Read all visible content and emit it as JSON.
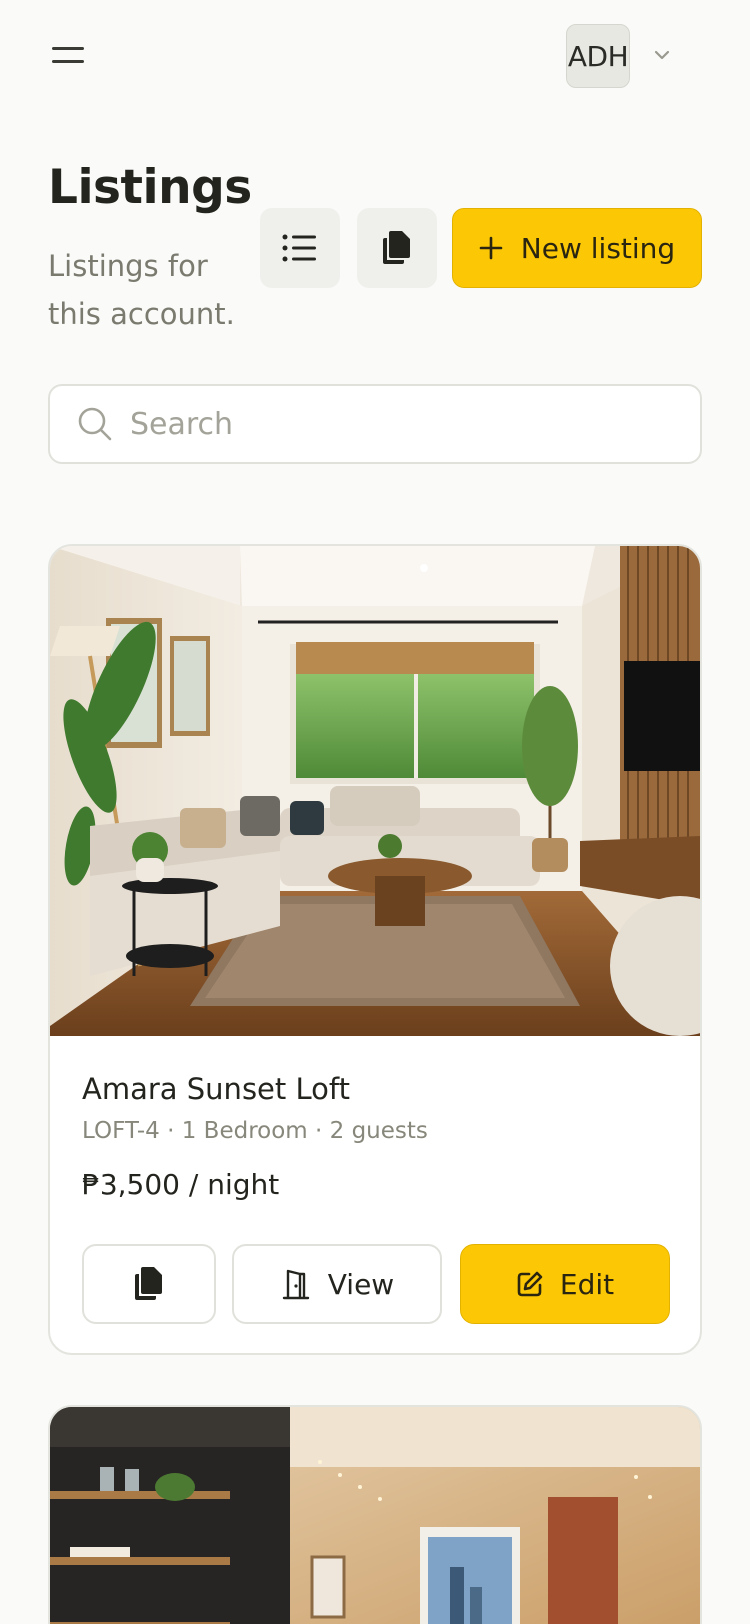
{
  "header": {
    "avatar_initials": "ADH"
  },
  "page": {
    "title": "Listings",
    "subtitle": "Listings for this account.",
    "new_listing_label": "New listing"
  },
  "search": {
    "placeholder": "Search"
  },
  "listings": [
    {
      "name": "Amara Sunset Loft",
      "meta": "LOFT-4 · 1 Bedroom · 2 guests",
      "price": "₱3,500 / night",
      "view_label": "View",
      "edit_label": "Edit"
    }
  ],
  "colors": {
    "accent": "#fcc805",
    "muted_text": "#7a7a6f"
  },
  "icons": [
    "menu-icon",
    "chevron-down-icon",
    "list-icon",
    "copy-icon",
    "plus-icon",
    "search-icon",
    "door-icon",
    "edit-icon"
  ]
}
